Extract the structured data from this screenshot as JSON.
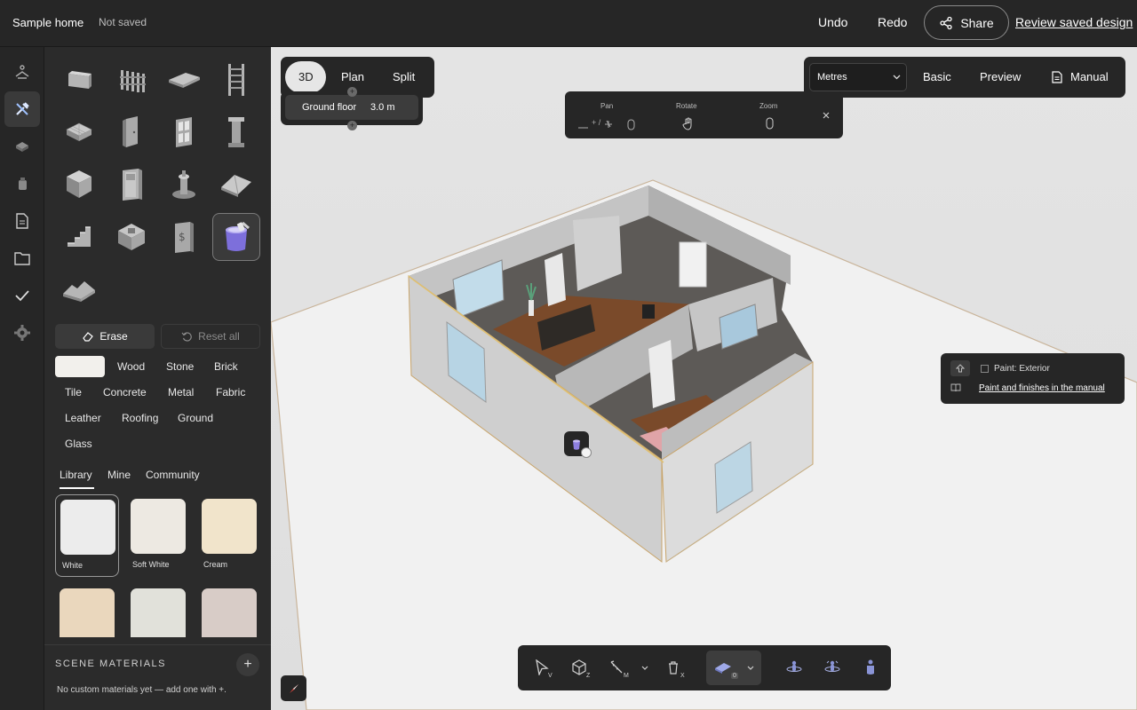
{
  "header": {
    "project_name": "Sample home",
    "save_status": "Not saved",
    "undo": "Undo",
    "redo": "Redo",
    "share": "Share",
    "review": "Review saved design"
  },
  "rail": {
    "items": [
      "structure-icon",
      "tools-icon",
      "furniture-icon",
      "objects-icon",
      "document-icon",
      "folder-icon",
      "check-icon",
      "settings-icon"
    ],
    "active": "tools-icon"
  },
  "tools": {
    "items": [
      "wall-tool",
      "fence-tool",
      "slab-tool",
      "ladder-tool",
      "floor-grid-tool",
      "door-tool",
      "window-tool",
      "column-tool",
      "box-tool",
      "cabinet-tool",
      "fixture-tool",
      "roof-tool",
      "stairs-tool",
      "room-tool",
      "elevator-tool",
      "paint-tool",
      "terrain-tool"
    ],
    "active": "paint-tool"
  },
  "paint": {
    "erase": "Erase",
    "reset": "Reset all",
    "categories": [
      "Wood",
      "Stone",
      "Brick",
      "Tile",
      "Concrete",
      "Metal",
      "Fabric",
      "Leather",
      "Roofing",
      "Ground",
      "Glass"
    ],
    "library_tabs": [
      "Library",
      "Mine",
      "Community"
    ],
    "active_tab": "Library",
    "materials": [
      {
        "name": "White",
        "color": "#ececec"
      },
      {
        "name": "Soft White",
        "color": "#ede9e2"
      },
      {
        "name": "Cream",
        "color": "#f1e4cb"
      },
      {
        "name": "",
        "color": "#ead7bd"
      },
      {
        "name": "",
        "color": "#e1e1da"
      },
      {
        "name": "",
        "color": "#d8ccc7"
      }
    ],
    "selected_material": "White",
    "scene_materials_title": "SCENE MATERIALS",
    "scene_add": "+",
    "scene_empty": "No custom materials yet — add one with +."
  },
  "viewport": {
    "view_tabs": [
      "3D",
      "Plan",
      "Split"
    ],
    "active_view": "3D",
    "floor_name": "Ground floor",
    "floor_height": "3.0 m",
    "units": "Metres",
    "right_buttons": [
      "Basic",
      "Preview",
      "Manual"
    ],
    "nav_help": {
      "pan": "Pan",
      "rotate": "Rotate",
      "zoom": "Zoom",
      "pan_hint": "+ /"
    },
    "paint_popup": {
      "title": "Paint: Exterior",
      "link": "Paint and finishes in the manual"
    },
    "bottom_tools": [
      {
        "icon": "select-icon",
        "key": "V"
      },
      {
        "icon": "cube-icon",
        "key": "Z"
      },
      {
        "icon": "measure-icon",
        "key": "M"
      },
      {
        "icon": "delete-icon",
        "key": "X"
      },
      {
        "icon": "paint-floor-icon",
        "key": "0"
      }
    ]
  },
  "colors": {
    "background": "#e6e6e6",
    "panel": "#262626",
    "accent_paint": "#8d7fe0"
  }
}
